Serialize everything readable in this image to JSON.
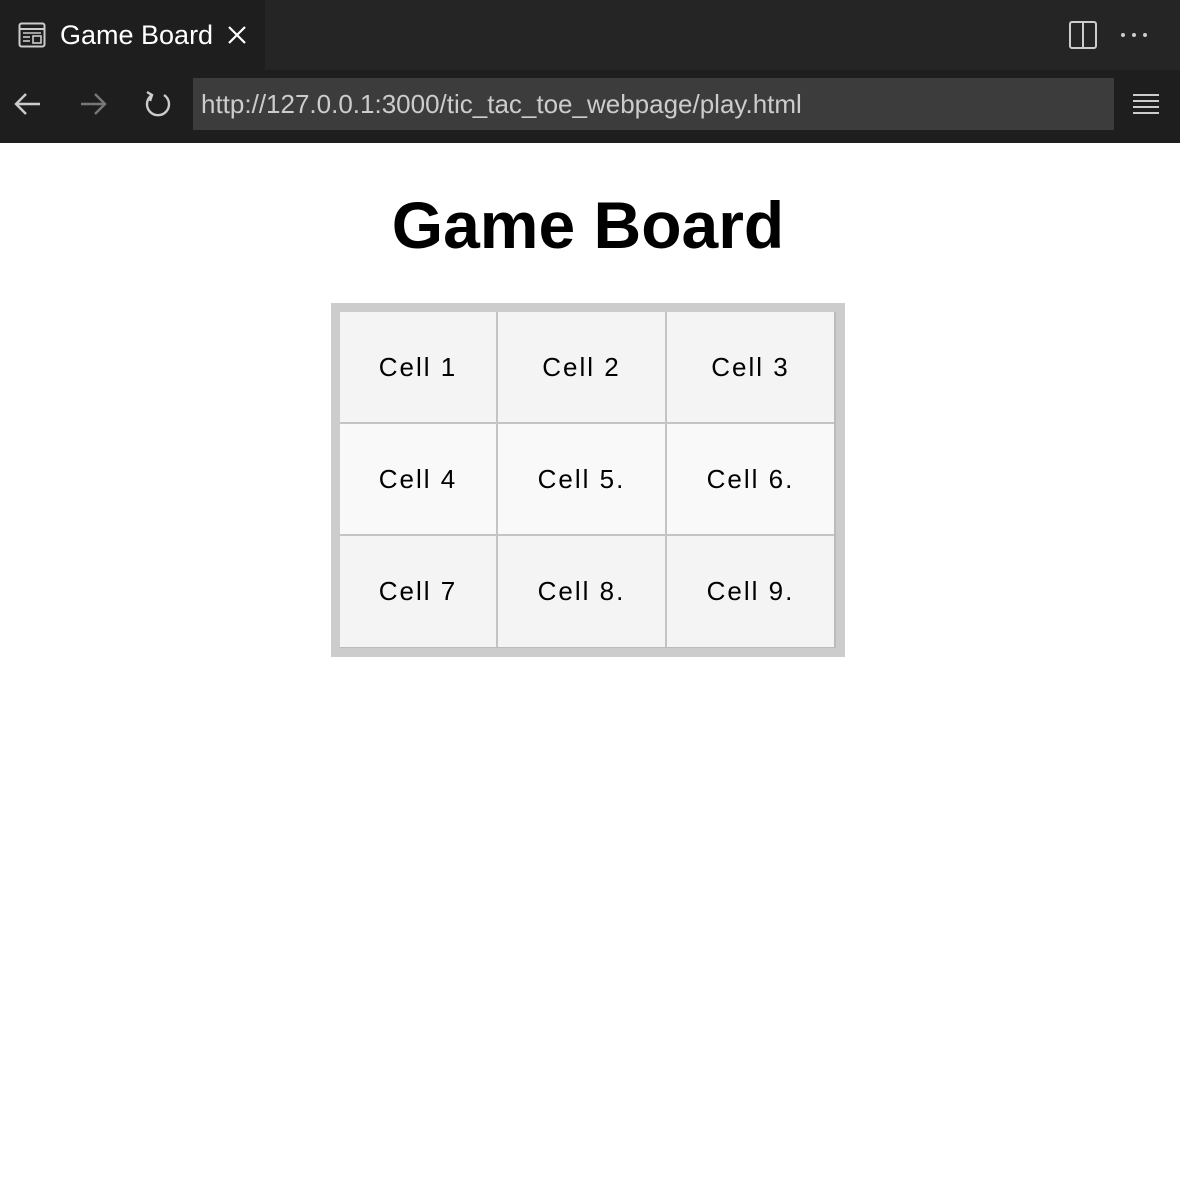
{
  "tab": {
    "title": "Game Board",
    "icon": "preview-icon"
  },
  "toolbar": {
    "url": "http://127.0.0.1:3000/tic_tac_toe_webpage/play.html",
    "back_icon": "arrow-left-icon",
    "forward_icon": "arrow-right-icon",
    "reload_icon": "reload-icon",
    "menu_icon": "menu-icon"
  },
  "page": {
    "title": "Game Board",
    "cells": [
      "Cell 1",
      "Cell 2",
      "Cell 3",
      "Cell 4",
      "Cell 5.",
      "Cell 6.",
      "Cell 7",
      "Cell 8.",
      "Cell 9."
    ]
  },
  "colors": {
    "chrome_dark": "#1e1e1e",
    "tabbar": "#252526",
    "url_bg": "#3c3c3c",
    "board_border": "#cccccc"
  }
}
